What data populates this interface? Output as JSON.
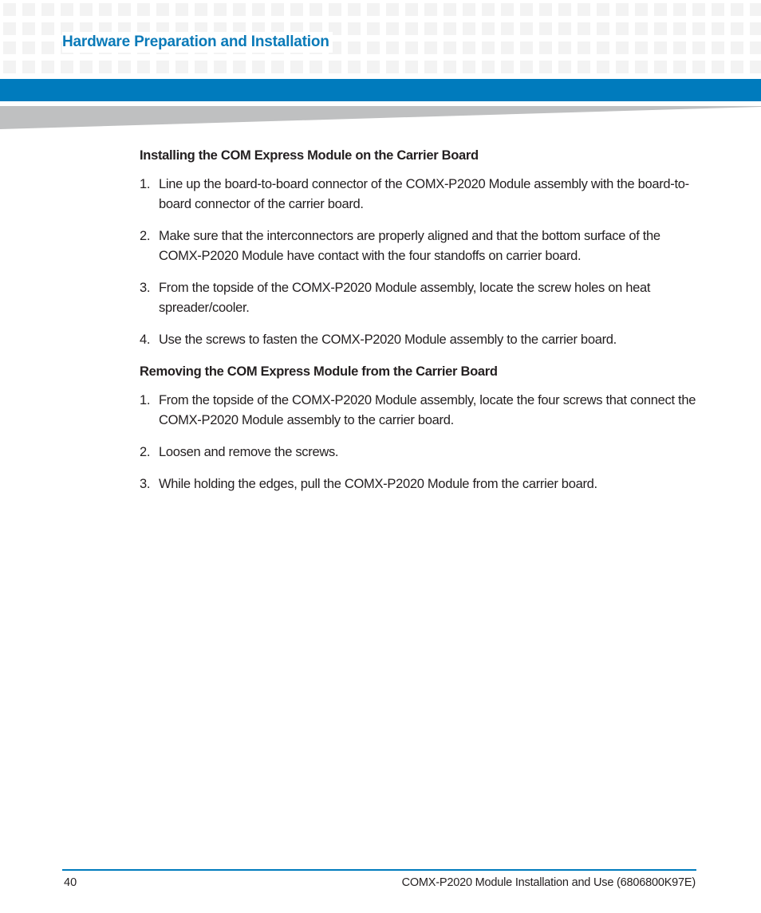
{
  "header": {
    "chapter_title": "Hardware Preparation and Installation",
    "colors": {
      "accent_blue": "#007bbd",
      "title_blue": "#0a7ab8",
      "wedge_grey": "#bfc0c1",
      "grid_square": "#f3f3f3"
    }
  },
  "sections": [
    {
      "heading": "Installing the COM Express Module on the Carrier Board",
      "steps": [
        {
          "num": "1.",
          "text": "Line up the board-to-board connector of the COMX-P2020 Module  assembly with the board-to-board connector of the carrier board."
        },
        {
          "num": "2.",
          "text": "Make sure that the interconnectors are properly aligned and that the bottom surface of the COMX-P2020 Module have contact with the four standoffs on carrier board."
        },
        {
          "num": "3.",
          "text": "From the topside of the COMX-P2020 Module assembly, locate the screw holes on heat spreader/cooler."
        },
        {
          "num": "4.",
          "text": "Use the screws to fasten the COMX-P2020 Module assembly to the carrier board."
        }
      ]
    },
    {
      "heading": "Removing the COM Express Module from the Carrier Board",
      "steps": [
        {
          "num": "1.",
          "text": "From the topside of the COMX-P2020 Module assembly, locate the four screws that connect the COMX-P2020 Module assembly to the carrier board."
        },
        {
          "num": "2.",
          "text": "Loosen and remove the screws."
        },
        {
          "num": "3.",
          "text": "While holding the edges, pull the COMX-P2020 Module from the carrier board."
        }
      ]
    }
  ],
  "footer": {
    "page_number": "40",
    "document_title": "COMX-P2020 Module Installation and Use (6806800K97E)"
  }
}
